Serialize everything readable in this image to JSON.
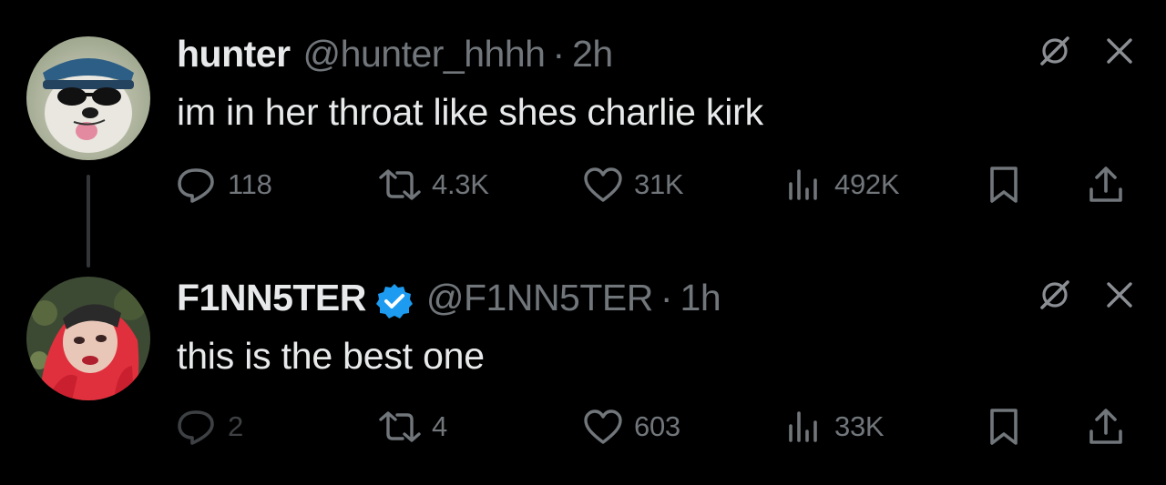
{
  "tweets": [
    {
      "display_name": "hunter",
      "handle": "@hunter_hhhh",
      "separator": "·",
      "time": "2h",
      "verified": false,
      "text": "im in her throat like shes charlie kirk",
      "stats": {
        "replies": "118",
        "retweets": "4.3K",
        "likes": "31K",
        "views": "492K"
      },
      "avatar": "dog-with-sunglasses-and-cap-avatar"
    },
    {
      "display_name": "F1NN5TER",
      "handle": "@F1NN5TER",
      "separator": "·",
      "time": "1h",
      "verified": true,
      "text": "this is the best one",
      "stats": {
        "replies": "2",
        "retweets": "4",
        "likes": "603",
        "views": "33K"
      },
      "avatar": "red-hair-person-avatar"
    }
  ],
  "colors": {
    "background": "#000000",
    "primary_text": "#e7e9ea",
    "secondary_text": "#71767b",
    "verified_blue": "#1d9bf0"
  },
  "icons": [
    "grok-icon",
    "close-icon",
    "reply-icon",
    "retweet-icon",
    "like-icon",
    "views-icon",
    "bookmark-icon",
    "share-icon",
    "verified-badge-icon"
  ]
}
